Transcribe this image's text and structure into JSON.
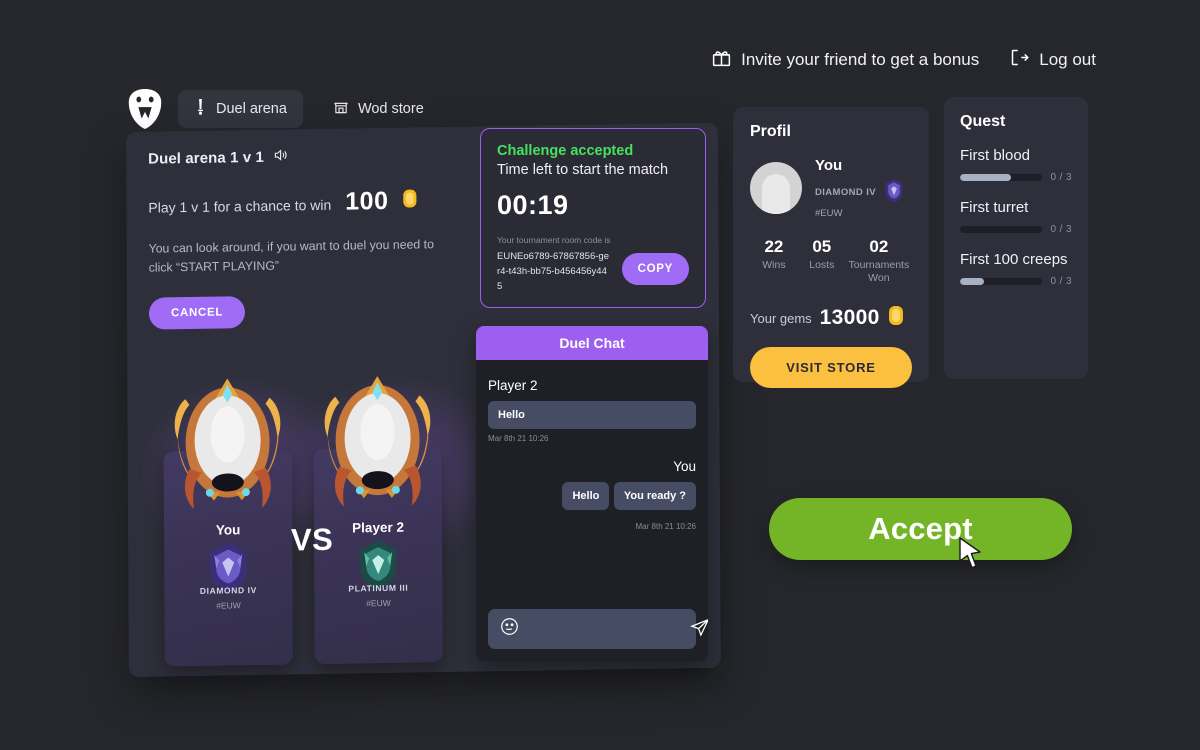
{
  "topbar": {
    "invite": {
      "label": "Invite your friend to get a bonus",
      "icon": "gift-icon"
    },
    "logout": {
      "label": "Log out",
      "icon": "logout-icon"
    }
  },
  "header": {
    "logo": "wod-logo-icon",
    "tabs": [
      {
        "label": "Duel arena",
        "icon": "sword-icon",
        "active": true
      },
      {
        "label": "Wod store",
        "icon": "store-icon",
        "active": false
      }
    ]
  },
  "duel": {
    "title": "Duel arena 1 v 1",
    "sound_icon": "speaker-icon",
    "reward_text": "Play 1 v 1 for a chance to win",
    "reward_amount": "100",
    "reward_icon": "gem-coin-icon",
    "hint": "You can look around, if you want to duel you need to click “START PLAYING”",
    "cancel_label": "CANCEL",
    "vs_label": "VS",
    "players": [
      {
        "name": "You",
        "rank": "DIAMOND IV",
        "server": "#EUW",
        "emblem": "diamond-rank-icon"
      },
      {
        "name": "Player 2",
        "rank": "PLATINUM III",
        "server": "#EUW",
        "emblem": "platinum-rank-icon"
      }
    ]
  },
  "challenge": {
    "status": "Challenge accepted",
    "subtitle": "Time left to start the match",
    "timer": "00:19",
    "code_label": "Your tournament room code is",
    "code": "EUNEo6789-67867856-ger4-t43h-bb75-b456456y445",
    "copy_label": "COPY"
  },
  "chat": {
    "title": "Duel Chat",
    "messages": [
      {
        "author": "Player 2",
        "side": "left",
        "texts": [
          "Hello"
        ],
        "timestamp": "Mar 8th 21 10:26"
      },
      {
        "author": "You",
        "side": "right",
        "texts": [
          "Hello",
          "You ready ?"
        ],
        "timestamp": "Mar 8th 21 10:26"
      }
    ],
    "input_placeholder": "",
    "emoji_icon": "smiley-icon",
    "send_icon": "send-icon"
  },
  "profil": {
    "title": "Profil",
    "user": {
      "name": "You",
      "rank": "DIAMOND IV",
      "server": "#EUW",
      "rank_icon": "diamond-rank-icon",
      "avatar": "avatar-placeholder"
    },
    "stats": [
      {
        "value": "22",
        "label": "Wins"
      },
      {
        "value": "05",
        "label": "Losts"
      },
      {
        "value": "02",
        "label": "Tournaments Won"
      }
    ],
    "gems_label": "Your gems",
    "gems_value": "13000",
    "gems_icon": "gem-coin-icon",
    "store_label": "VISIT STORE"
  },
  "quest": {
    "title": "Quest",
    "items": [
      {
        "name": "First blood",
        "progress": "0 / 3",
        "fill_pct": 63
      },
      {
        "name": "First turret",
        "progress": "0 / 3",
        "fill_pct": 0
      },
      {
        "name": "First 100 creeps",
        "progress": "0 / 3",
        "fill_pct": 30
      }
    ]
  },
  "accept": {
    "label": "Accept"
  },
  "colors": {
    "page_bg": "#26272c",
    "panel_bg": "#2e2f3a",
    "purple": "#9d5ff0",
    "green_accept": "#74b427",
    "green_status": "#45e25e",
    "gold": "#fbc03f"
  }
}
